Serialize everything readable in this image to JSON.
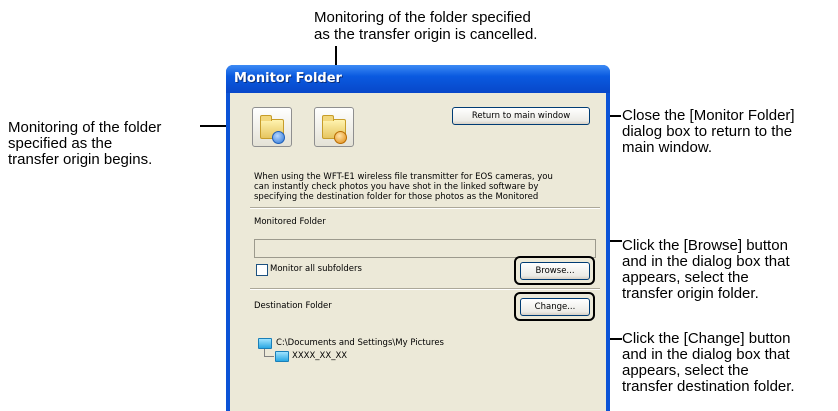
{
  "callouts": {
    "top": [
      "Monitoring of the folder specified",
      "as the transfer origin is cancelled."
    ],
    "left": [
      "Monitoring of the folder",
      "specified as the",
      "transfer origin begins."
    ],
    "return": [
      "Close the [Monitor Folder]",
      "dialog box to return to the",
      "main window."
    ],
    "browse": [
      "Click the [Browse] button",
      "and in the dialog box that",
      "appears, select the",
      "transfer origin folder."
    ],
    "change": [
      "Click the [Change] button",
      "and in the dialog box that",
      "appears, select the",
      "transfer destination folder."
    ]
  },
  "dialog": {
    "title": "Monitor Folder",
    "return_button": "Return to main window",
    "description": [
      "When using the WFT-E1 wireless file transmitter for EOS cameras, you",
      "can instantly check photos you have shot in the linked software by",
      "specifying the destination folder for those photos as the Monitored"
    ],
    "monitored_label": "Monitored Folder",
    "monitored_value": "",
    "subfolders_label": "Monitor all subfolders",
    "subfolders_checked": false,
    "browse_button": "Browse...",
    "destination_label": "Destination Folder",
    "change_button": "Change...",
    "tree": {
      "root": "C:\\Documents and Settings\\My Pictures",
      "child": "XXXX_XX_XX"
    }
  },
  "colors": {
    "titlebar": "#0a5ae0",
    "client_bg": "#ece9d8",
    "button_border": "#003c74"
  },
  "icons": [
    "start-monitor-icon",
    "stop-monitor-icon"
  ]
}
